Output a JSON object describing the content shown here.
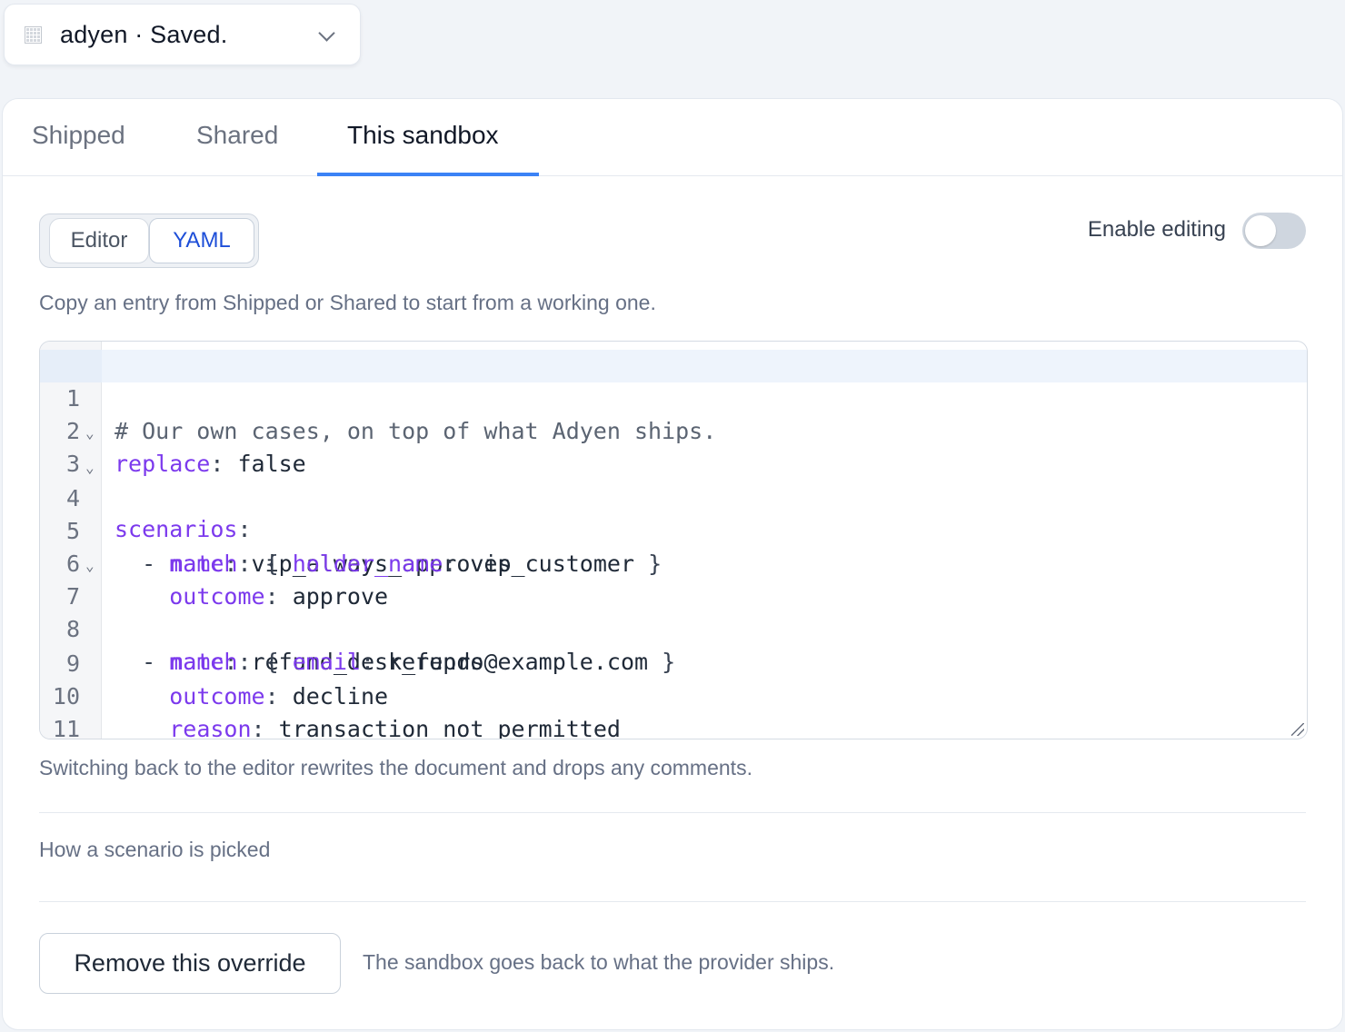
{
  "picker": {
    "label": "adyen · Saved.",
    "icon": "grid-icon",
    "chevron_icon": "chevron-down-icon"
  },
  "tabs": [
    {
      "label": "Shipped",
      "active": false
    },
    {
      "label": "Shared",
      "active": false
    },
    {
      "label": "This sandbox",
      "active": true
    }
  ],
  "mode_switch": {
    "options": [
      "Editor",
      "YAML"
    ],
    "selected": "YAML"
  },
  "toggle": {
    "label": "Enable editing",
    "on": false
  },
  "hint_top": "Copy an entry from Shipped or Shared to start from a working one.",
  "editor": {
    "active_line": 1,
    "lines": [
      {
        "num": "1",
        "fold": false
      },
      {
        "num": "2",
        "fold": false
      },
      {
        "num": "3",
        "fold": true
      },
      {
        "num": "4",
        "fold": true
      },
      {
        "num": "5",
        "fold": false
      },
      {
        "num": "6",
        "fold": false
      },
      {
        "num": "7",
        "fold": true
      },
      {
        "num": "8",
        "fold": false
      },
      {
        "num": "9",
        "fold": false
      },
      {
        "num": "10",
        "fold": false
      },
      {
        "num": "11",
        "fold": false
      }
    ],
    "fold_glyph": "⌄",
    "tokens": {
      "l1": "# Our own cases, on top of what Adyen ships.",
      "l2_key": "replace",
      "l2_val": " false",
      "l3_key": "scenarios",
      "l4_dash": "  - ",
      "l4_key": "name",
      "l4_val": " vip_always_approves",
      "l5_key": "match",
      "l5_open": " { ",
      "l5_key2": "holder_name",
      "l5_val": " vip_customer ",
      "l5_close": "}",
      "l6_key": "outcome",
      "l6_val": " approve",
      "l7_dash": "  - ",
      "l7_key": "name",
      "l7_val": " refund_desk_repro",
      "l8_key": "match",
      "l8_open": " { ",
      "l8_key2": "email",
      "l8_val": " refunds@example.com ",
      "l8_close": "}",
      "l9_key": "outcome",
      "l9_val": " decline",
      "l10_key": "reason",
      "l10_val": " transaction_not_permitted",
      "colon": ":"
    }
  },
  "hint_bottom": "Switching back to the editor rewrites the document and drops any comments.",
  "section_label": "How a scenario is picked",
  "remove": {
    "button_label": "Remove this override",
    "note": "The sandbox goes back to what the provider ships."
  }
}
